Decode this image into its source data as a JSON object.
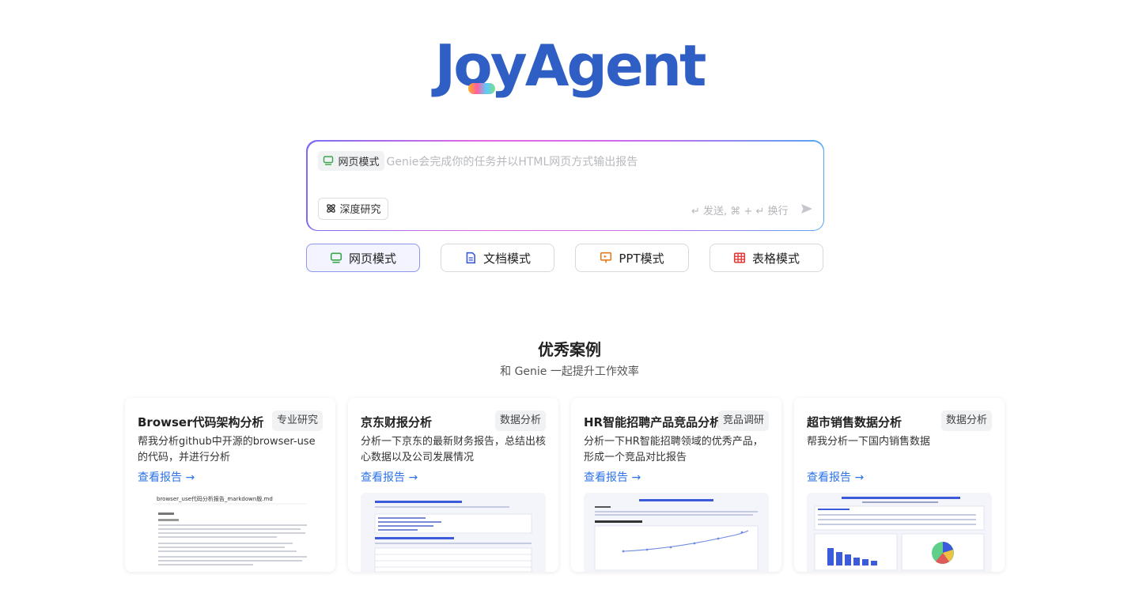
{
  "brand": {
    "logo_text": "JoyAgent"
  },
  "composer": {
    "mode_chip": "网页模式",
    "placeholder": "Genie会完成你的任务并以HTML网页方式输出报告",
    "deep_research": "深度研究",
    "hint": "↵ 发送, ⌘ + ↵ 换行",
    "send_icon": "send-icon"
  },
  "modes": [
    {
      "label": "网页模式",
      "icon": "monitor-icon",
      "color": "#3aa64a",
      "active": true
    },
    {
      "label": "文档模式",
      "icon": "document-icon",
      "color": "#3b5bdb",
      "active": false
    },
    {
      "label": "PPT模式",
      "icon": "presentation-icon",
      "color": "#e67b1c",
      "active": false
    },
    {
      "label": "表格模式",
      "icon": "table-icon",
      "color": "#e03b3b",
      "active": false
    }
  ],
  "section": {
    "title": "优秀案例",
    "subtitle": "和 Genie 一起提升工作效率"
  },
  "cards": [
    {
      "title": "Browser代码架构分析",
      "tag": "专业研究",
      "desc": "帮我分析github中开源的browser-use的代码，并进行分析",
      "link": "查看报告",
      "preview_title": "browser_use代码分析报告_markdown版.md"
    },
    {
      "title": "京东财报分析",
      "tag": "数据分析",
      "desc": "分析一下京东的最新财务报告，总结出核心数据以及公司发展情况",
      "link": "查看报告",
      "preview_title": ""
    },
    {
      "title": "HR智能招聘产品竞品分析",
      "tag": "竞品调研",
      "desc": "分析一下HR智能招聘领域的优秀产品，形成一个竞品对比报告",
      "link": "查看报告",
      "preview_title": ""
    },
    {
      "title": "超市销售数据分析",
      "tag": "数据分析",
      "desc": "帮我分析一下国内销售数据",
      "link": "查看报告",
      "preview_title": ""
    }
  ],
  "colors": {
    "accent": "#2e73e8",
    "brand": "#2f5fc4"
  }
}
